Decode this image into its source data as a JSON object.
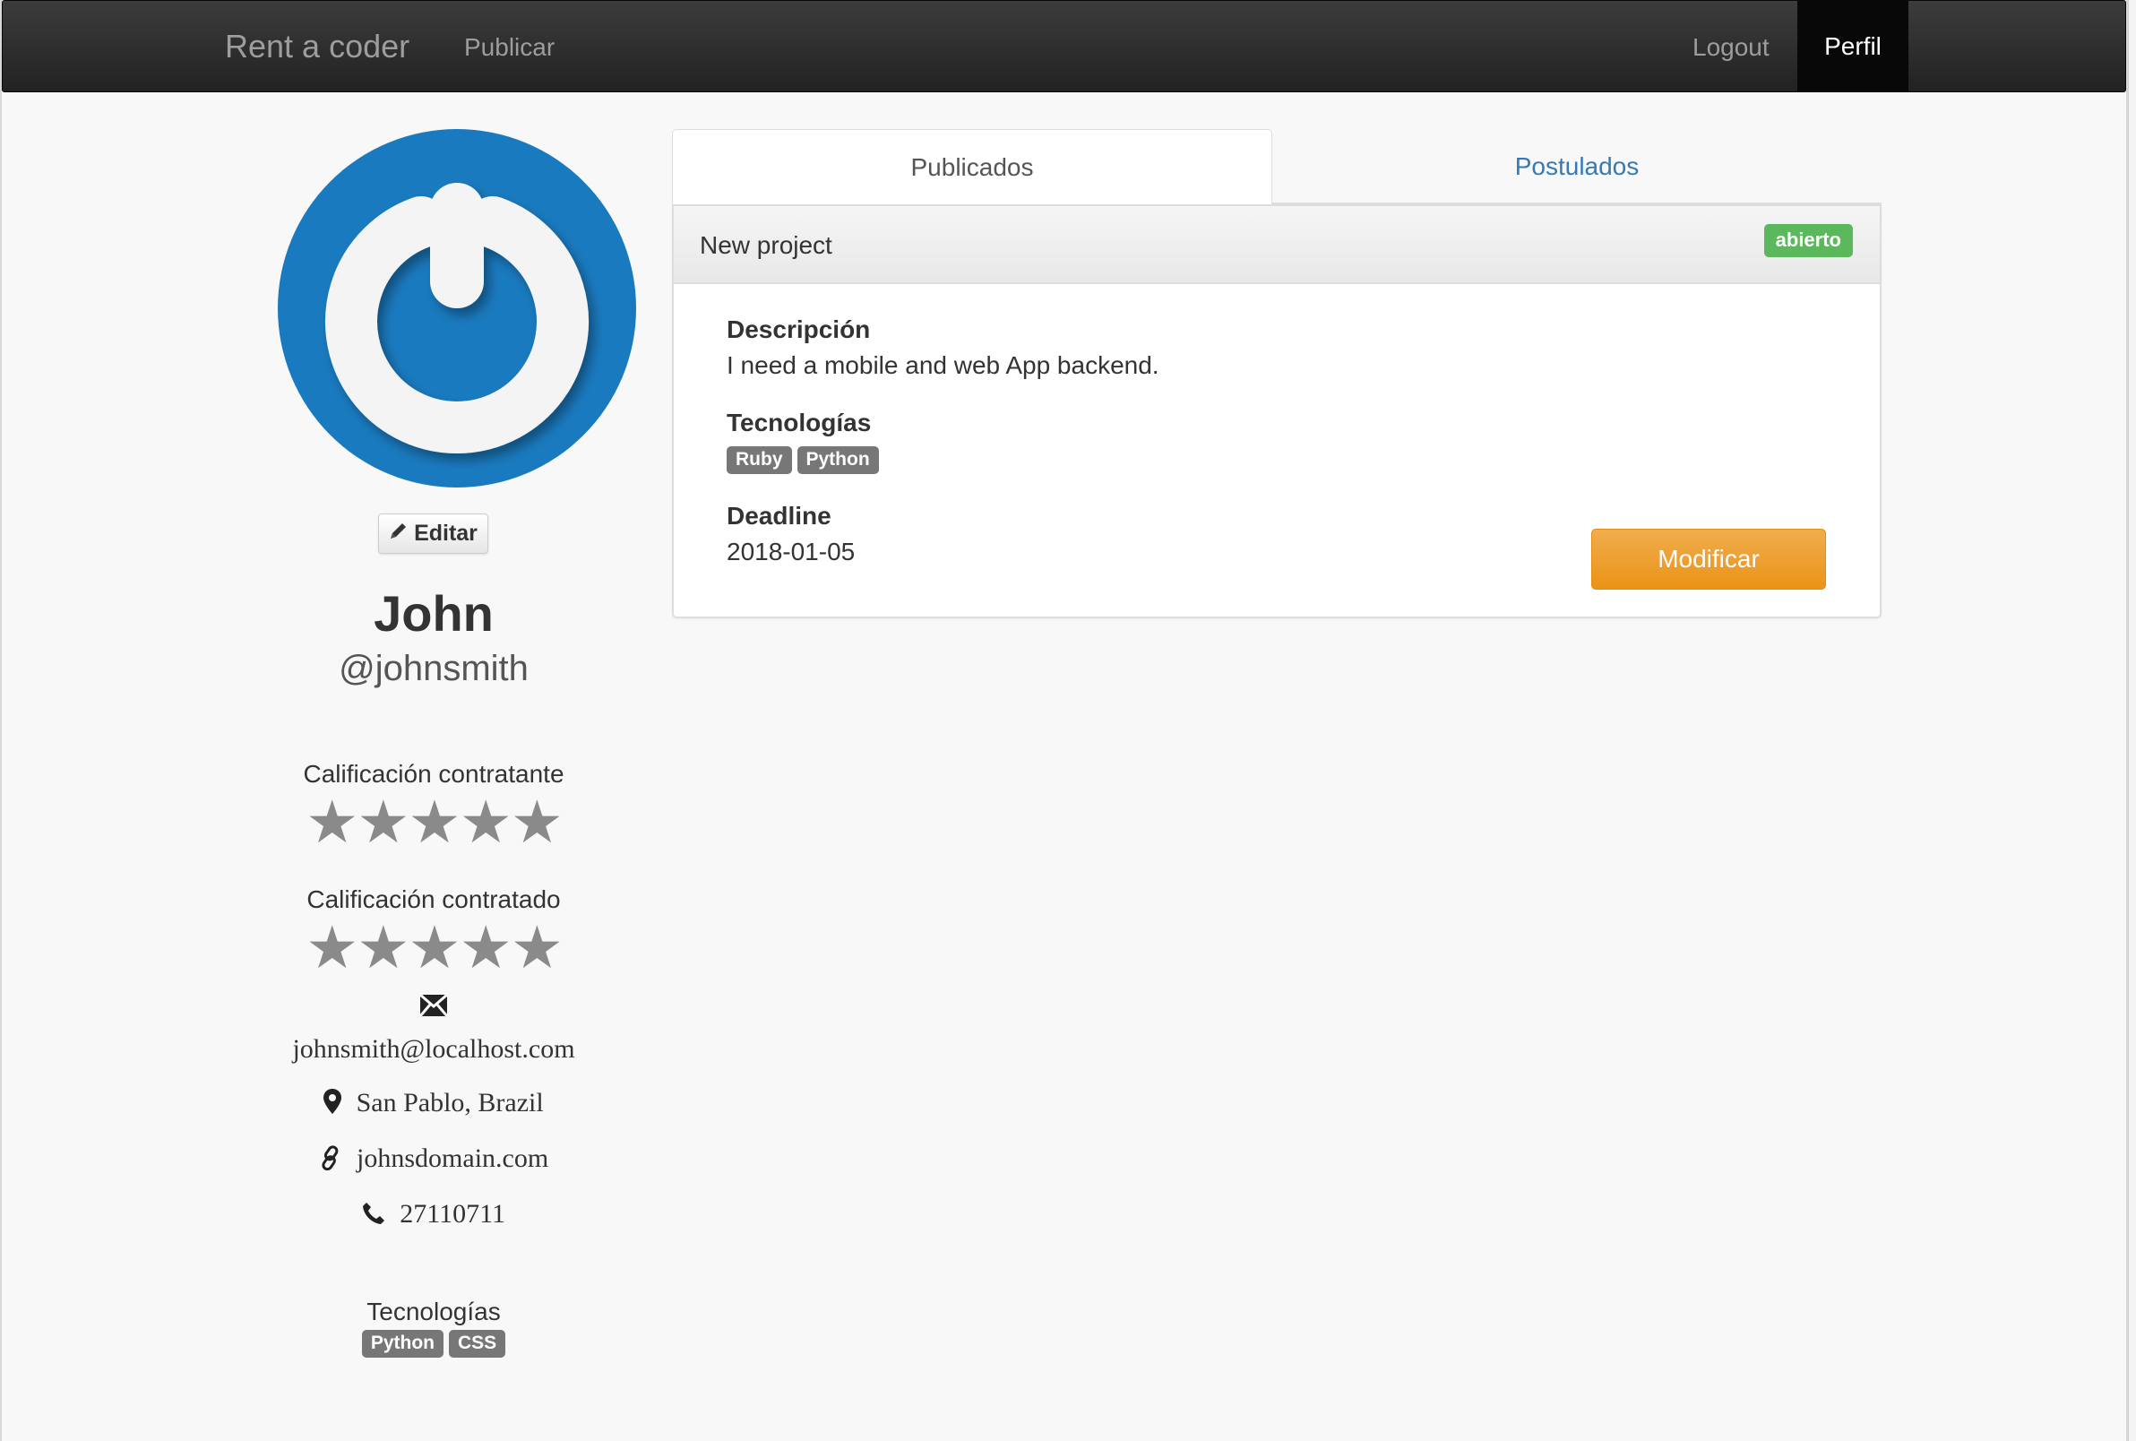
{
  "navbar": {
    "brand": "Rent a coder",
    "publish": "Publicar",
    "logout": "Logout",
    "profile": "Perfil"
  },
  "profile": {
    "edit_label": "Editar",
    "name": "John",
    "username": "@johnsmith",
    "rating_hirer_label": "Calificación contratante",
    "rating_hirer_stars": "★★★★★",
    "rating_hired_label": "Calificación contratado",
    "rating_hired_stars": "★★★★★",
    "email": "johnsmith@localhost.com",
    "location": "San Pablo, Brazil",
    "website": "johnsdomain.com",
    "phone": "27110711",
    "tech_label": "Tecnologías",
    "technologies": [
      "Python",
      "CSS"
    ]
  },
  "tabs": {
    "published": "Publicados",
    "applied": "Postulados"
  },
  "project": {
    "title": "New project",
    "status": "abierto",
    "description_label": "Descripción",
    "description": "I need a mobile and web App backend.",
    "tech_label": "Tecnologías",
    "technologies": [
      "Ruby",
      "Python"
    ],
    "deadline_label": "Deadline",
    "deadline": "2018-01-05",
    "modify_label": "Modificar"
  },
  "icons": {
    "star": "star-icon",
    "email": "envelope-icon",
    "location": "map-marker-icon",
    "link": "link-icon",
    "phone": "phone-icon",
    "edit": "pencil-icon"
  },
  "colors": {
    "avatar_blue": "#1a7abf",
    "status_open": "#5cb85c",
    "modify_button": "#f0ad4e",
    "link_blue": "#337ab7"
  }
}
